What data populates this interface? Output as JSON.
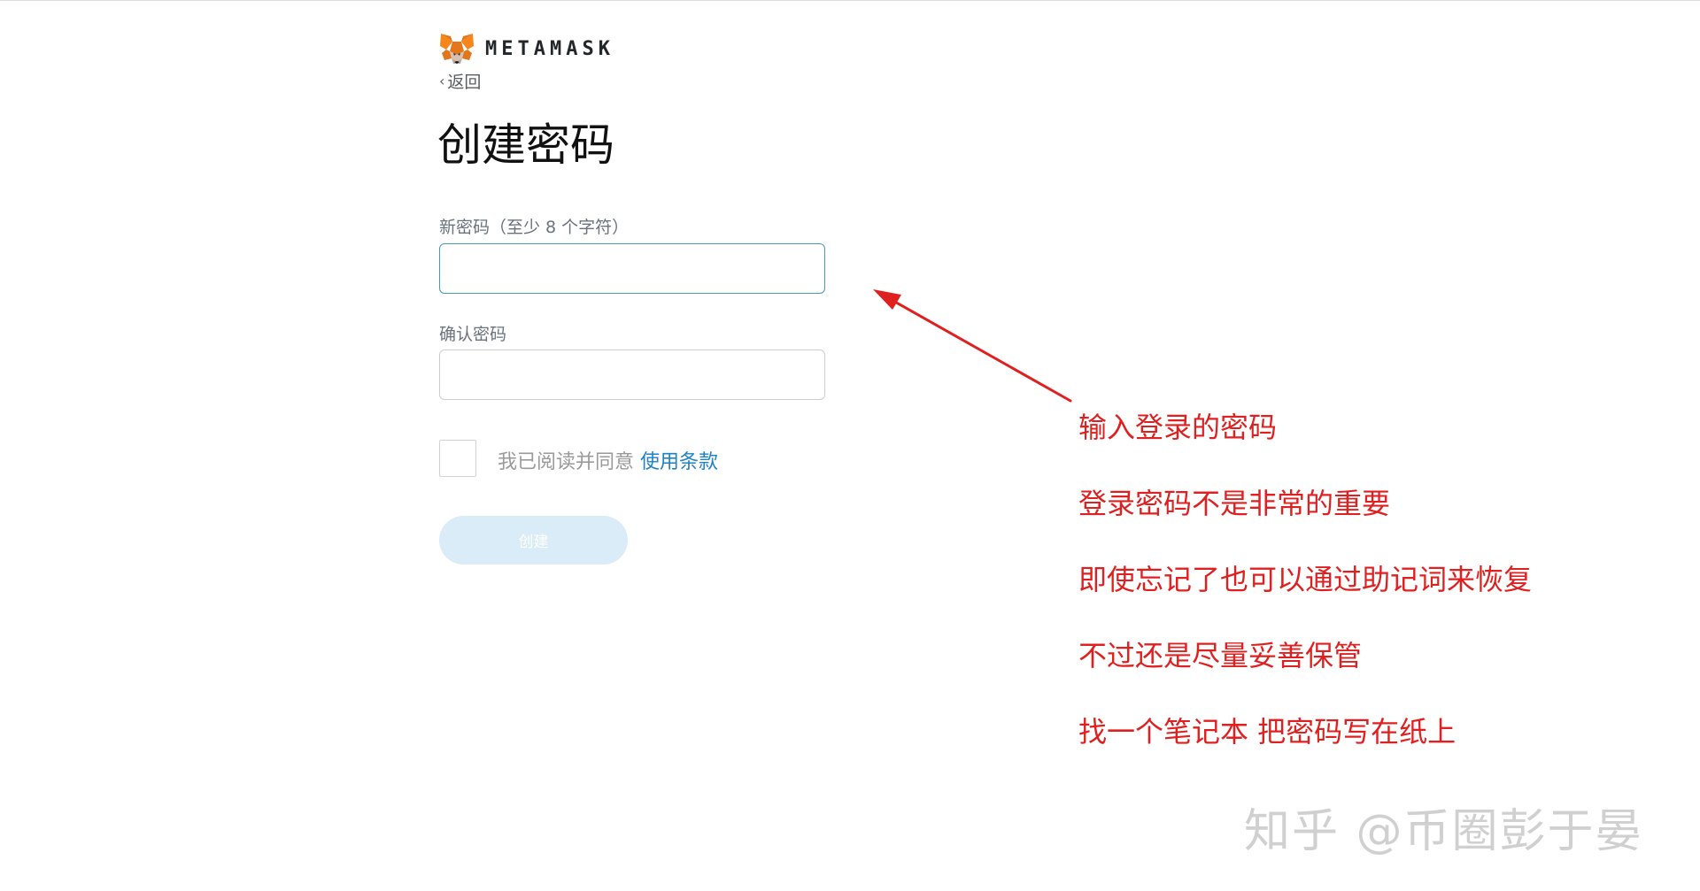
{
  "brand": {
    "name": "METAMASK",
    "logo_icon": "metamask-fox-icon"
  },
  "nav": {
    "back_label": "返回",
    "back_icon": "chevron-left-icon"
  },
  "form": {
    "title": "创建密码",
    "new_password_label": "新密码（至少 8 个字符）",
    "new_password_value": "",
    "confirm_password_label": "确认密码",
    "confirm_password_value": "",
    "agree_text": "我已阅读并同意 ",
    "terms_link": "使用条款",
    "create_button": "创建",
    "agree_checked": false,
    "create_button_enabled": false
  },
  "annotations": [
    "输入登录的密码",
    "登录密码不是非常的重要",
    "即使忘记了也可以通过助记词来恢复",
    "不过还是尽量妥善保管",
    "找一个笔记本 把密码写在纸上"
  ],
  "watermark": "知乎 @币圈彭于晏",
  "colors": {
    "accent": "#1f82c4",
    "input_focus_border": "#4a9ab8",
    "disabled_button": "#d9ecf7",
    "annotation_red": "#e02020"
  }
}
